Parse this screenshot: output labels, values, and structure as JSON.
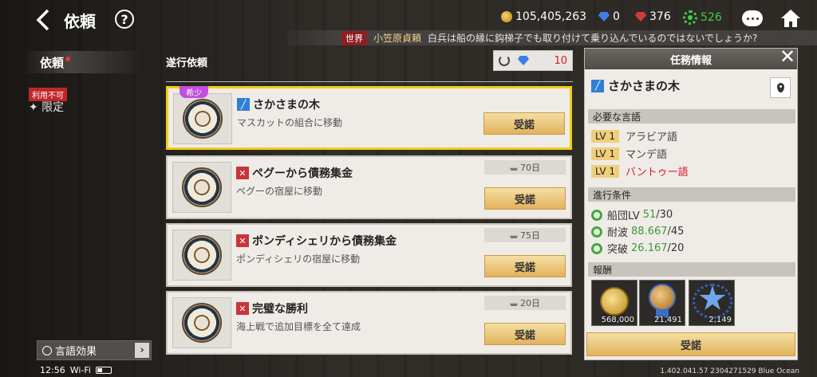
{
  "header": {
    "title": "依頼",
    "help": "?",
    "currencies": {
      "gold": "105,405,263",
      "blue_gem": "0",
      "red_gem": "376",
      "green": "526"
    }
  },
  "ticker": {
    "tag": "世界",
    "user": "小笠原貞頼",
    "message": "白兵は船の縁に鈎梯子でも取り付けて乗り込んでいるのではないでしょうか?"
  },
  "sidebar": {
    "active_tab": "依頼",
    "unavailable_badge": "利用不可",
    "limited_label": "✦ 限定",
    "language_effect": "言語効果",
    "language_chevron": "›"
  },
  "list": {
    "header": "遂行依頼",
    "refresh_count": "10",
    "rare_badge": "希少",
    "quests": [
      {
        "title": "さかさまの木",
        "desc": "マスカットの組合に移動",
        "days": "",
        "accept": "受諾",
        "type": "blue"
      },
      {
        "title": "ペグーから債務集金",
        "desc": "ペグーの宿屋に移動",
        "days": "70日",
        "accept": "受諾",
        "type": "red"
      },
      {
        "title": "ポンディシェリから債務集金",
        "desc": "ポンディシェリの宿屋に移動",
        "days": "75日",
        "accept": "受諾",
        "type": "red"
      },
      {
        "title": "完璧な勝利",
        "desc": "海上戦で追加目標を全て達成",
        "days": "20日",
        "accept": "受諾",
        "type": "red"
      }
    ]
  },
  "panel": {
    "title": "任務情報",
    "quest_title": "さかさまの木",
    "languages_header": "必要な言語",
    "languages": [
      {
        "lv": "LV 1",
        "name": "アラビア語",
        "ok": true
      },
      {
        "lv": "LV 1",
        "name": "マンデ語",
        "ok": true
      },
      {
        "lv": "LV 1",
        "name": "バントゥー語",
        "ok": false
      }
    ],
    "conditions_header": "進行条件",
    "conditions": [
      {
        "label": "船団LV",
        "current": "51",
        "required": "/30"
      },
      {
        "label": "耐波",
        "current": "88.667",
        "required": "/45"
      },
      {
        "label": "突破",
        "current": "26.167",
        "required": "/20"
      }
    ],
    "rewards_header": "報酬",
    "rewards": [
      {
        "count": "568,000",
        "icon": "gold-coin-icon"
      },
      {
        "count": "21,491",
        "icon": "medal-icon"
      },
      {
        "count": "2,149",
        "icon": "star-badge-icon"
      }
    ],
    "accept": "受諾"
  },
  "statusbar": {
    "time": "12:56",
    "wifi": "Wi-Fi",
    "version": "1.402.041.57 2304271529 Blue Ocean"
  },
  "colors": {
    "accent_gold": "#e2b25d",
    "selected_border": "#f0cf11",
    "rare_purple": "#c34ee0",
    "ok_green": "#3a9a3a",
    "warn_red": "#d21e2a"
  }
}
